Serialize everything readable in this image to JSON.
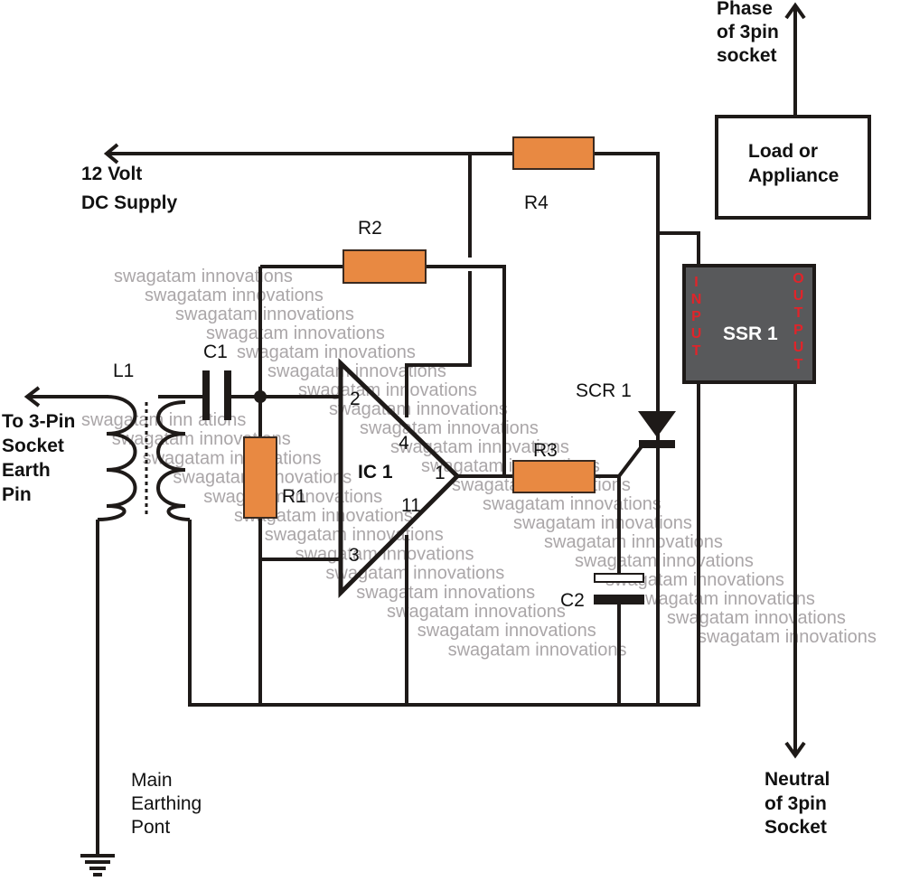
{
  "watermark": "swagatam innovations",
  "watermark_partial": "swagatam inn  ations",
  "labels": {
    "supply_line1": "12 Volt",
    "supply_line2": "DC Supply",
    "earth_pin": [
      "To 3-Pin",
      "Socket",
      "Earth",
      "Pin"
    ],
    "main_earth": [
      "Main",
      "Earthing",
      "Pont"
    ],
    "phase": [
      "Phase",
      "of 3pin",
      "socket"
    ],
    "neutral": [
      "Neutral",
      "of 3pin",
      "Socket"
    ],
    "load": [
      "Load or",
      "Appliance"
    ]
  },
  "components": {
    "L1": "L1",
    "C1": "C1",
    "R1": "R1",
    "R2": "R2",
    "R3": "R3",
    "R4": "R4",
    "IC1": "IC 1",
    "SCR1": "SCR 1",
    "C2": "C2",
    "SSR1": "SSR 1",
    "ssr_input": "INPUT",
    "ssr_output": "OUTPUT",
    "pins": {
      "p2": "2",
      "p3": "3",
      "p4": "4",
      "p1": "1",
      "p11": "11"
    }
  },
  "colors": {
    "resistor": "#e88942",
    "ssr_body": "#58595b",
    "ssr_text": "#e0242a",
    "watermark": "#aaa6a8"
  }
}
